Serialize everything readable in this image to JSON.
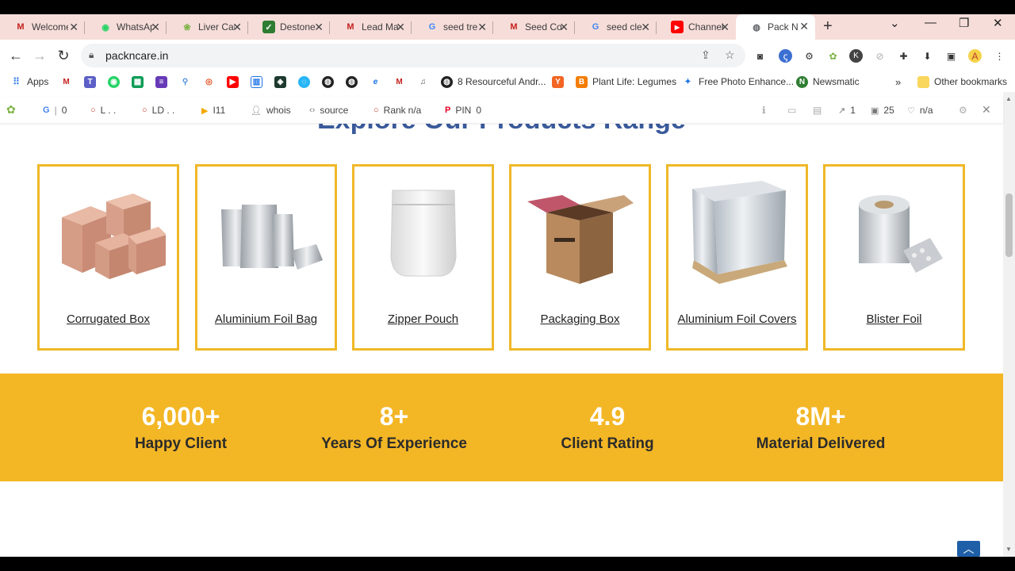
{
  "tabs": [
    {
      "title": "Welcome",
      "icon": "gmail-icon",
      "color": "#c5221f"
    },
    {
      "title": "WhatsApp",
      "icon": "whatsapp-icon",
      "color": "#25d366"
    },
    {
      "title": "Liver Care",
      "icon": "leaf-icon",
      "color": "#7cb342"
    },
    {
      "title": "Destone",
      "icon": "check-icon",
      "color": "#2e7d32"
    },
    {
      "title": "Lead Ma",
      "icon": "gmail-icon",
      "color": "#c5221f"
    },
    {
      "title": "seed tre",
      "icon": "google-icon",
      "color": "#4285f4"
    },
    {
      "title": "Seed Co",
      "icon": "gmail-icon",
      "color": "#c5221f"
    },
    {
      "title": "seed cle",
      "icon": "google-icon",
      "color": "#4285f4"
    },
    {
      "title": "Channel",
      "icon": "youtube-icon",
      "color": "#ff0000"
    },
    {
      "title": "Pack N C",
      "icon": "globe-icon",
      "color": "#5f6368"
    }
  ],
  "address": {
    "url": "packncare.in"
  },
  "bookmarks": {
    "apps": "Apps",
    "resourceful": "8 Resourceful Andr...",
    "plant_life": "Plant Life: Legumes",
    "photo": "Free Photo Enhance...",
    "newsmatic": "Newsmatic",
    "other": "Other bookmarks"
  },
  "seo": {
    "g_count": "0",
    "l_text": "L . .",
    "ld_text": "LD . .",
    "i11": "I11",
    "whois": "whois",
    "source": "source",
    "rank_label": "Rank",
    "rank_value": "n/a",
    "pin_label": "PIN",
    "pin_value": "0",
    "links": "1",
    "pages": "25",
    "na": "n/a"
  },
  "page": {
    "heading": "Explore Our Products Range",
    "products": [
      {
        "name": "Corrugated Box",
        "icon": "cardboard-boxes-image"
      },
      {
        "name": "Aluminium Foil Bag",
        "icon": "foil-bags-image"
      },
      {
        "name": "Zipper Pouch",
        "icon": "zipper-pouch-image"
      },
      {
        "name": "Packaging Box",
        "icon": "open-box-image"
      },
      {
        "name": "Aluminium Foil Covers",
        "icon": "foil-cover-pallet-image"
      },
      {
        "name": "Blister Foil",
        "icon": "blister-foil-roll-image"
      }
    ],
    "stats": [
      {
        "number": "6,000+",
        "label": "Happy Client"
      },
      {
        "number": "8+",
        "label": "Years Of Experience"
      },
      {
        "number": "4.9",
        "label": "Client Rating"
      },
      {
        "number": "8M+",
        "label": "Material Delivered"
      }
    ]
  },
  "colors": {
    "accent": "#f3b625",
    "card_border": "#f0b828",
    "heading": "#3a5a9b",
    "tabstrip": "#f6ddd9"
  }
}
